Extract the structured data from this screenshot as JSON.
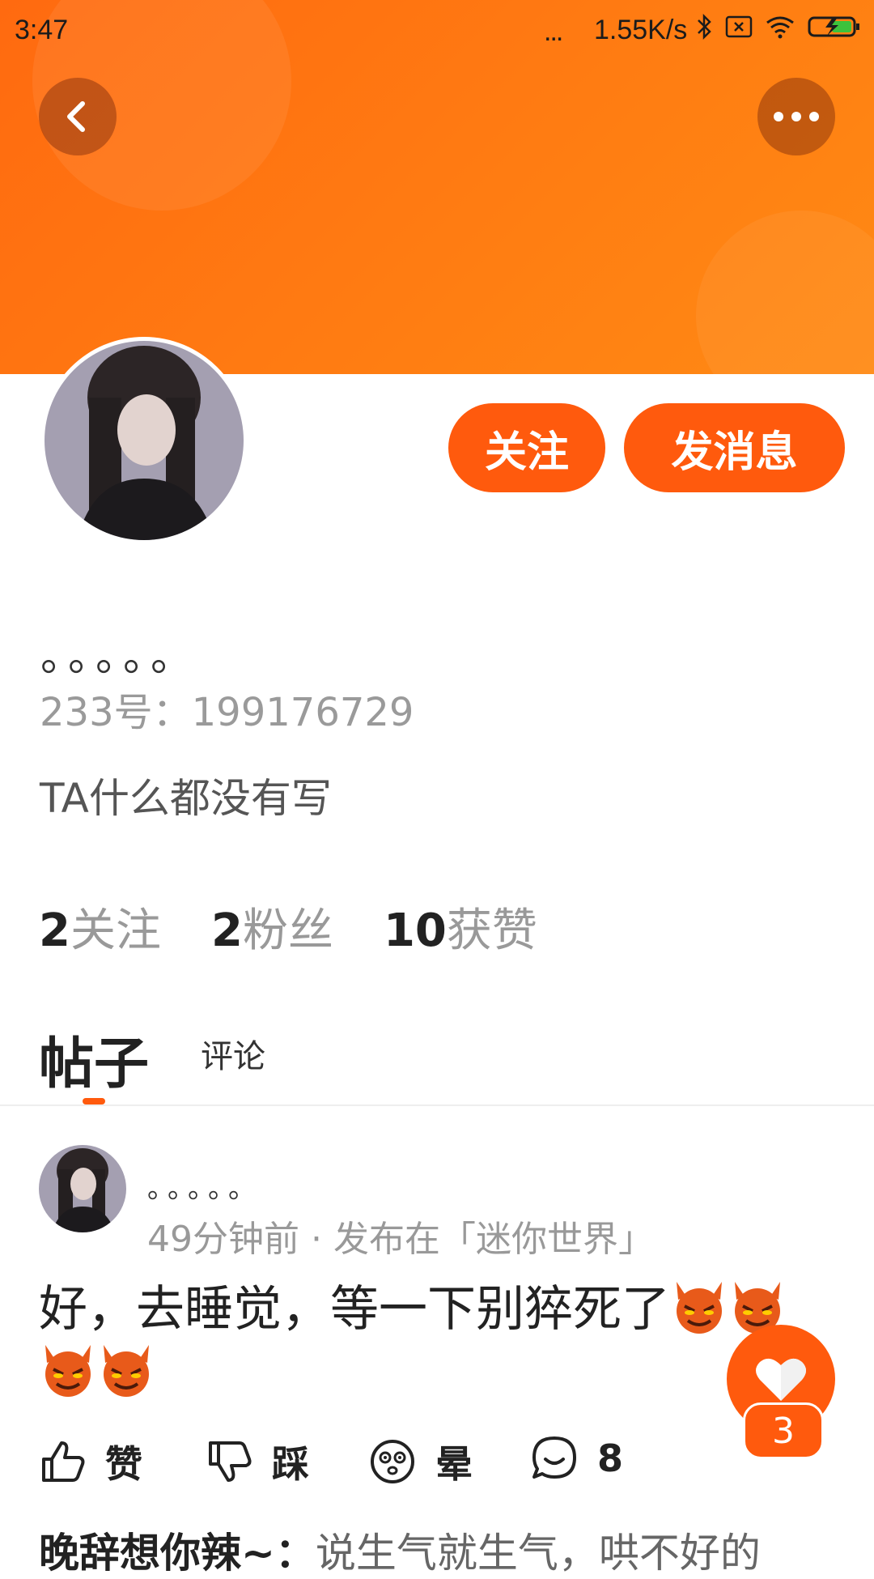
{
  "status_bar": {
    "time": "3:47",
    "dots": "...",
    "net_speed": "1.55K/s"
  },
  "colors": {
    "accent": "#ff5a0d",
    "header_gradient_start": "#ff6a10",
    "header_gradient_end": "#ff8a14"
  },
  "header": {
    "icons": [
      "back-icon",
      "more-icon"
    ]
  },
  "profile": {
    "follow_label": "关注",
    "message_label": "发消息",
    "nickname": "。。。。。",
    "uid": "233号：199176729",
    "bio": "TA什么都没有写",
    "stats": [
      {
        "num": "2",
        "label": "关注"
      },
      {
        "num": "2",
        "label": "粉丝"
      },
      {
        "num": "10",
        "label": "获赞"
      }
    ]
  },
  "tabs": {
    "posts": "帖子",
    "comments": "评论",
    "active": "posts"
  },
  "post": {
    "author": "。。。。。",
    "meta": "49分钟前 · 发布在「迷你世界」",
    "text": "好，去睡觉，等一下别猝死了",
    "emoji_count": 4,
    "emoji_icon": "smiling-devil-icon",
    "like_fab_count": "3",
    "actions": [
      {
        "icon": "thumbs-up-icon",
        "label": "赞"
      },
      {
        "icon": "thumbs-down-icon",
        "label": "踩"
      },
      {
        "icon": "dizzy-face-icon",
        "label": "晕"
      },
      {
        "icon": "comment-icon",
        "label": "8"
      }
    ]
  },
  "comment_preview": {
    "user": "晚辞想你辣~：",
    "text": "说生气就生气，哄不好的"
  }
}
